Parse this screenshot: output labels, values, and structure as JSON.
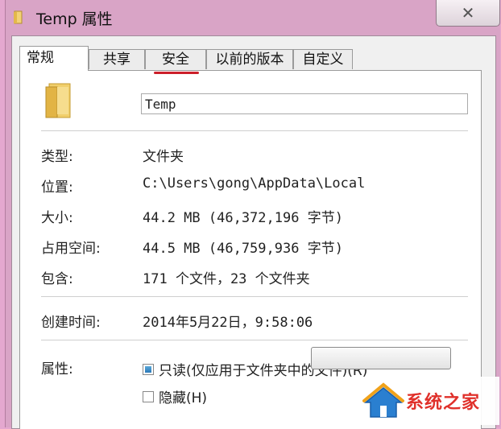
{
  "window": {
    "title": "Temp 属性",
    "close_glyph": "✕"
  },
  "tabs": [
    {
      "label": "常规",
      "active": true
    },
    {
      "label": "共享"
    },
    {
      "label": "安全"
    },
    {
      "label": "以前的版本"
    },
    {
      "label": "自定义"
    }
  ],
  "general": {
    "name_value": "Temp",
    "type": {
      "label": "类型:",
      "value": "文件夹"
    },
    "location": {
      "label": "位置:",
      "value": "C:\\Users\\gong\\AppData\\Local"
    },
    "size": {
      "label": "大小:",
      "value": "44.2 MB (46,372,196 字节)"
    },
    "size_on_disk": {
      "label": "占用空间:",
      "value": "44.5 MB (46,759,936 字节)"
    },
    "contains": {
      "label": "包含:",
      "value": "171 个文件，23 个文件夹"
    },
    "created": {
      "label": "创建时间:",
      "value": "2014年5月22日，9:58:06"
    },
    "attributes": {
      "label": "属性:",
      "readonly": "只读(仅应用于文件夹中的文件)(R)",
      "hidden": "隐藏(H)"
    }
  },
  "watermark": {
    "text": "系统之家"
  },
  "colors": {
    "accent_red": "#cc1f2a",
    "titlebar": "#d9a4c6",
    "folder": "#e8c15a"
  }
}
